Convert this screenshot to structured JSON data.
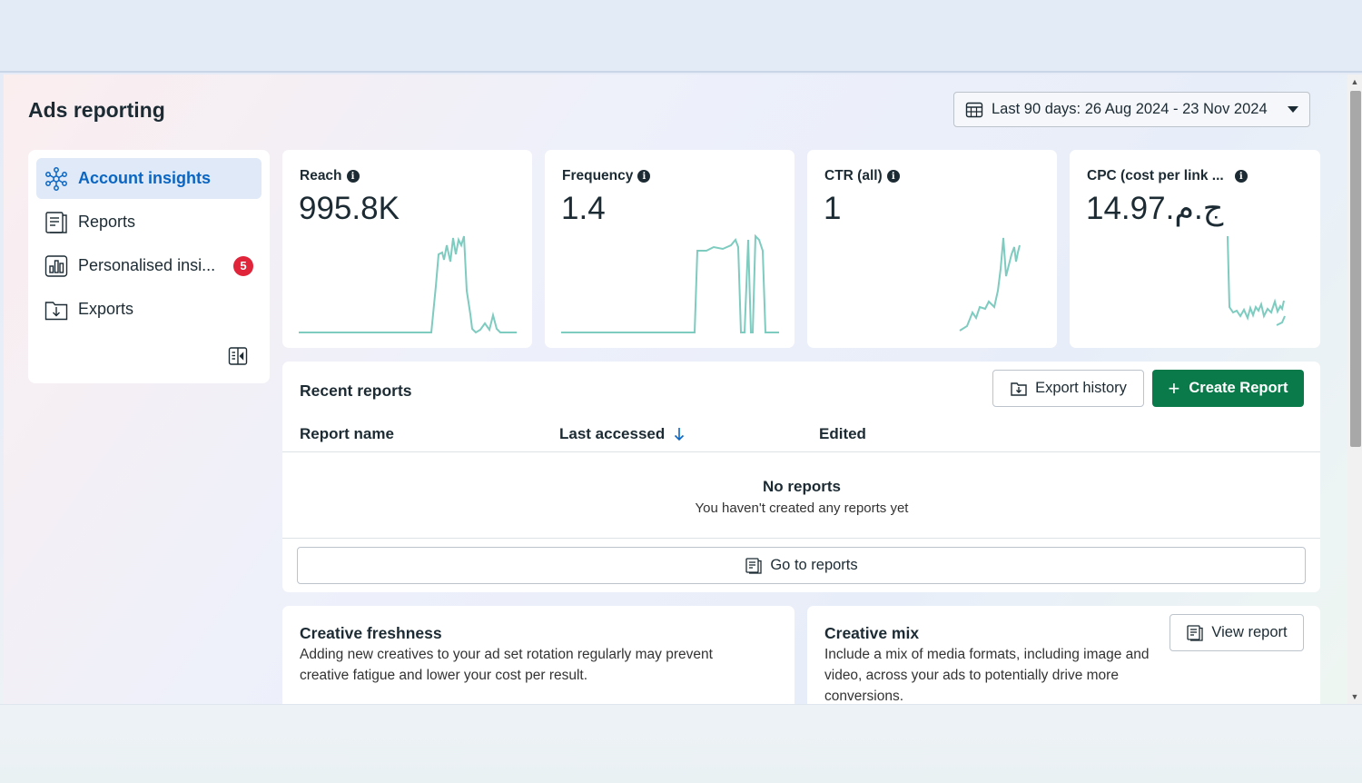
{
  "page": {
    "title": "Ads reporting"
  },
  "date_range": {
    "label": "Last 90 days: 26 Aug 2024 - 23 Nov 2024"
  },
  "sidebar": {
    "items": [
      {
        "label": "Account insights",
        "icon": "network-icon",
        "active": true
      },
      {
        "label": "Reports",
        "icon": "reports-icon"
      },
      {
        "label": "Personalised insi...",
        "icon": "bar-chart-icon",
        "badge": "5"
      },
      {
        "label": "Exports",
        "icon": "export-folder-icon"
      }
    ]
  },
  "metrics": [
    {
      "title": "Reach",
      "value": "995.8K"
    },
    {
      "title": "Frequency",
      "value": "1.4"
    },
    {
      "title": "CTR (all)",
      "value": "1"
    },
    {
      "title": "CPC (cost per link ...",
      "value": "14.97.ج.م"
    }
  ],
  "colors": {
    "accent": "#0a66c2",
    "primary_button": "#0b7a4b",
    "sparkline": "#7ecbc0",
    "badge": "#e0243a"
  },
  "recent_reports": {
    "title": "Recent reports",
    "export_history_label": "Export history",
    "create_report_label": "Create Report",
    "columns": [
      "Report name",
      "Last accessed",
      "Edited"
    ],
    "empty_title": "No reports",
    "empty_subtitle": "You haven't created any reports yet",
    "go_to_reports_label": "Go to reports"
  },
  "creative_freshness": {
    "title": "Creative freshness",
    "description": "Adding new creatives to your ad set rotation regularly may prevent creative fatigue and lower your cost per result."
  },
  "creative_mix": {
    "title": "Creative mix",
    "description": "Include a mix of media formats, including image and video, across your ads to potentially drive more conversions.",
    "view_report_label": "View report"
  }
}
